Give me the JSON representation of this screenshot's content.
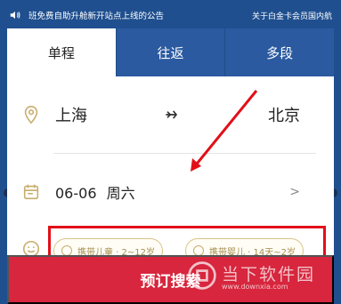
{
  "notice": {
    "text": "班免费自助升舱新开站点上线的公告",
    "right_text": "关于白金卡会员国内航"
  },
  "tabs": [
    {
      "label": "单程",
      "active": true
    },
    {
      "label": "往返",
      "active": false
    },
    {
      "label": "多段",
      "active": false
    }
  ],
  "route": {
    "from": "上海",
    "to": "北京"
  },
  "date": {
    "value": "06-06",
    "weekday": "周六"
  },
  "passengers": [
    {
      "label": "携带儿童 · 2~12岁"
    },
    {
      "label": "携带婴儿 · 14天~2岁"
    }
  ],
  "actions": {
    "search_label": "预订搜索"
  },
  "watermark": {
    "title": "当下软件园",
    "url": "www.downxia.com"
  },
  "colors": {
    "primary_blue": "#2b5aa0",
    "accent_red": "#d7263d",
    "highlight_red": "#e20f18",
    "gold": "#c8ad6b"
  },
  "icons": {
    "notice": "speaker-icon",
    "location": "location-pin-icon",
    "swap": "plane-swap-icon",
    "calendar": "calendar-icon",
    "passenger": "smile-icon",
    "chevron": "chevron-right-icon"
  }
}
